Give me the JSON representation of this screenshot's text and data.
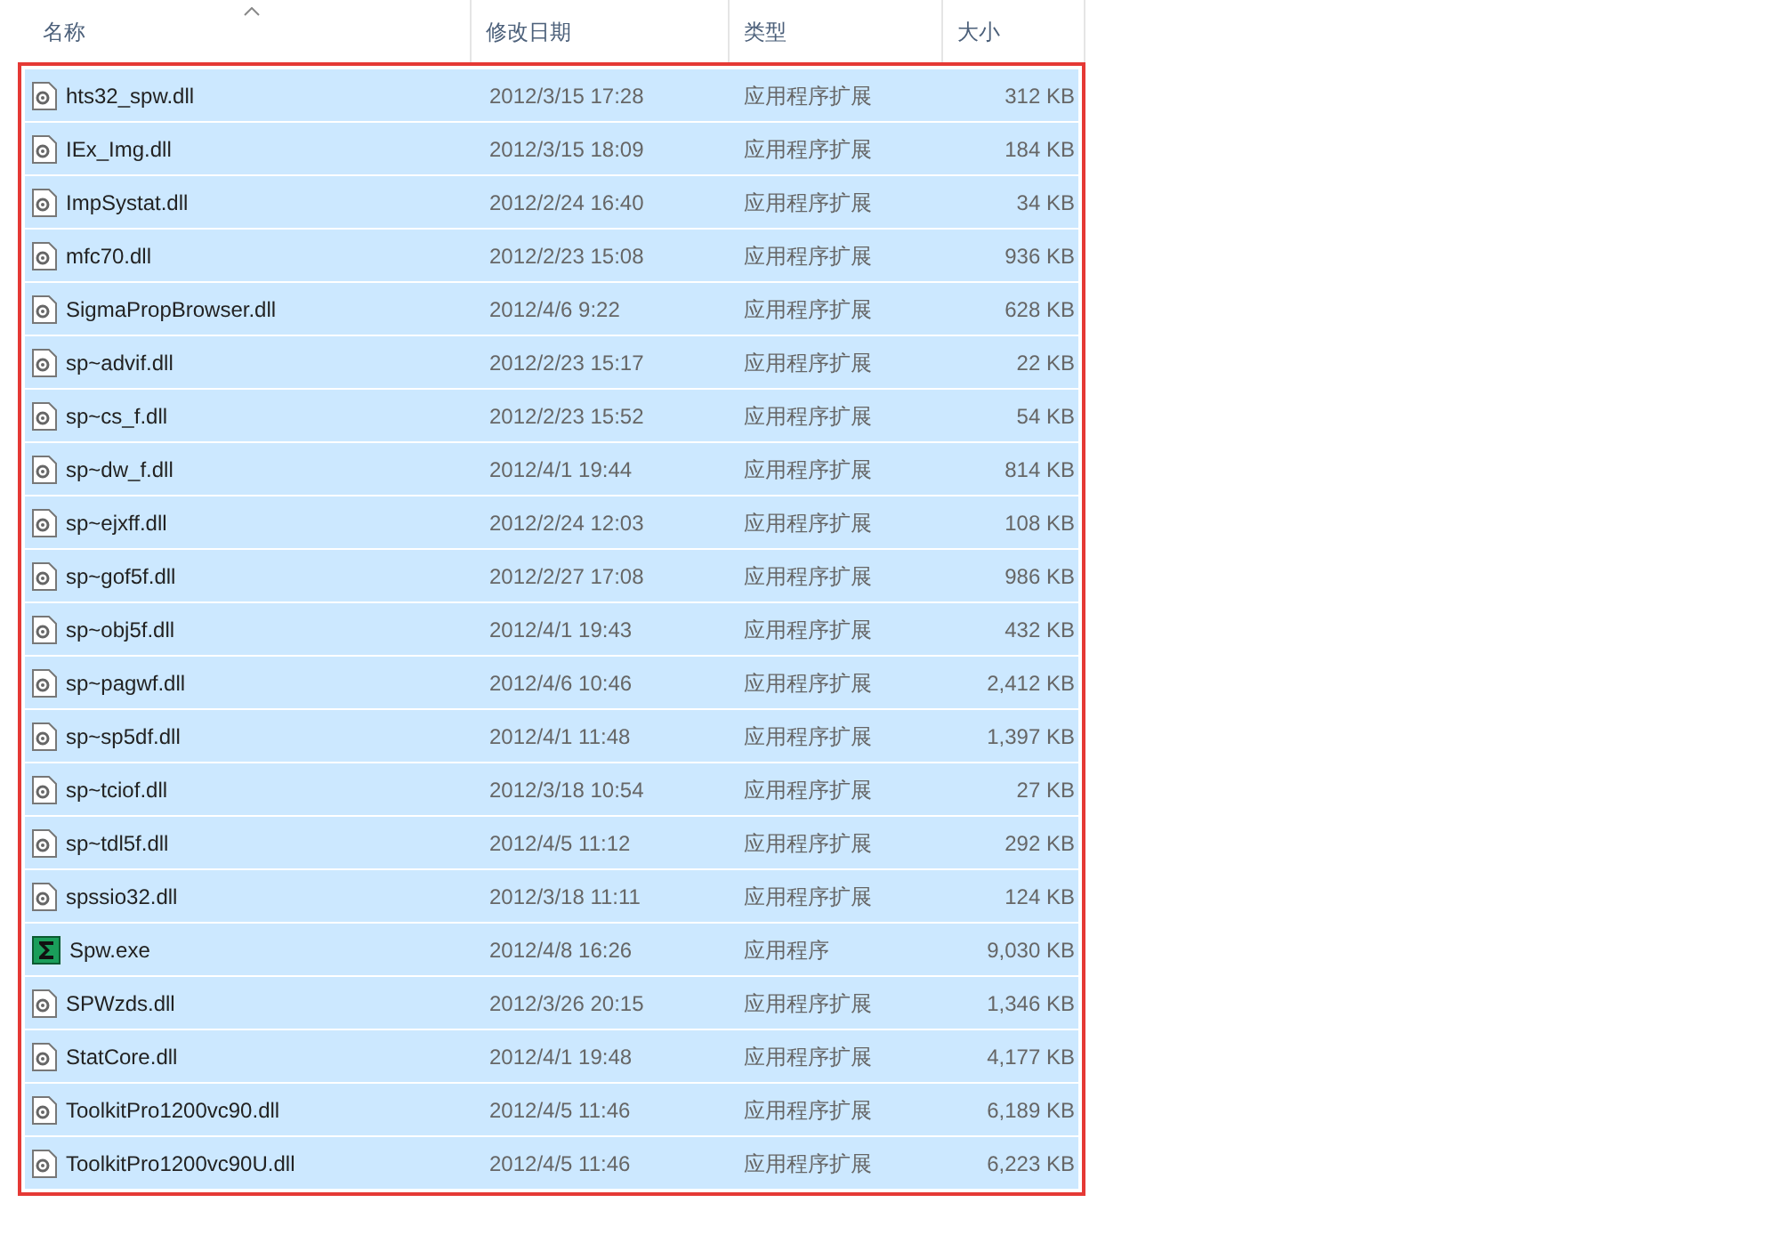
{
  "columns": [
    {
      "label": "名称",
      "sorted": true
    },
    {
      "label": "修改日期",
      "sorted": false
    },
    {
      "label": "类型",
      "sorted": false
    },
    {
      "label": "大小",
      "sorted": false
    }
  ],
  "highlight_box": true,
  "rows": [
    {
      "name": "hts32_spw.dll",
      "date": "2012/3/15 17:28",
      "type": "应用程序扩展",
      "size": "312 KB",
      "kind": "dll",
      "selected": true
    },
    {
      "name": "IEx_Img.dll",
      "date": "2012/3/15 18:09",
      "type": "应用程序扩展",
      "size": "184 KB",
      "kind": "dll",
      "selected": true
    },
    {
      "name": "ImpSystat.dll",
      "date": "2012/2/24 16:40",
      "type": "应用程序扩展",
      "size": "34 KB",
      "kind": "dll",
      "selected": true
    },
    {
      "name": "mfc70.dll",
      "date": "2012/2/23 15:08",
      "type": "应用程序扩展",
      "size": "936 KB",
      "kind": "dll",
      "selected": true
    },
    {
      "name": "SigmaPropBrowser.dll",
      "date": "2012/4/6 9:22",
      "type": "应用程序扩展",
      "size": "628 KB",
      "kind": "dll",
      "selected": true
    },
    {
      "name": "sp~advif.dll",
      "date": "2012/2/23 15:17",
      "type": "应用程序扩展",
      "size": "22 KB",
      "kind": "dll",
      "selected": true
    },
    {
      "name": "sp~cs_f.dll",
      "date": "2012/2/23 15:52",
      "type": "应用程序扩展",
      "size": "54 KB",
      "kind": "dll",
      "selected": true
    },
    {
      "name": "sp~dw_f.dll",
      "date": "2012/4/1 19:44",
      "type": "应用程序扩展",
      "size": "814 KB",
      "kind": "dll",
      "selected": true
    },
    {
      "name": "sp~ejxff.dll",
      "date": "2012/2/24 12:03",
      "type": "应用程序扩展",
      "size": "108 KB",
      "kind": "dll",
      "selected": true
    },
    {
      "name": "sp~gof5f.dll",
      "date": "2012/2/27 17:08",
      "type": "应用程序扩展",
      "size": "986 KB",
      "kind": "dll",
      "selected": true
    },
    {
      "name": "sp~obj5f.dll",
      "date": "2012/4/1 19:43",
      "type": "应用程序扩展",
      "size": "432 KB",
      "kind": "dll",
      "selected": true
    },
    {
      "name": "sp~pagwf.dll",
      "date": "2012/4/6 10:46",
      "type": "应用程序扩展",
      "size": "2,412 KB",
      "kind": "dll",
      "selected": true
    },
    {
      "name": "sp~sp5df.dll",
      "date": "2012/4/1 11:48",
      "type": "应用程序扩展",
      "size": "1,397 KB",
      "kind": "dll",
      "selected": true
    },
    {
      "name": "sp~tciof.dll",
      "date": "2012/3/18 10:54",
      "type": "应用程序扩展",
      "size": "27 KB",
      "kind": "dll",
      "selected": true
    },
    {
      "name": "sp~tdl5f.dll",
      "date": "2012/4/5 11:12",
      "type": "应用程序扩展",
      "size": "292 KB",
      "kind": "dll",
      "selected": true
    },
    {
      "name": "spssio32.dll",
      "date": "2012/3/18 11:11",
      "type": "应用程序扩展",
      "size": "124 KB",
      "kind": "dll",
      "selected": true
    },
    {
      "name": "Spw.exe",
      "date": "2012/4/8 16:26",
      "type": "应用程序",
      "size": "9,030 KB",
      "kind": "exe",
      "selected": true
    },
    {
      "name": "SPWzds.dll",
      "date": "2012/3/26 20:15",
      "type": "应用程序扩展",
      "size": "1,346 KB",
      "kind": "dll",
      "selected": true
    },
    {
      "name": "StatCore.dll",
      "date": "2012/4/1 19:48",
      "type": "应用程序扩展",
      "size": "4,177 KB",
      "kind": "dll",
      "selected": true
    },
    {
      "name": "ToolkitPro1200vc90.dll",
      "date": "2012/4/5 11:46",
      "type": "应用程序扩展",
      "size": "6,189 KB",
      "kind": "dll",
      "selected": true
    },
    {
      "name": "ToolkitPro1200vc90U.dll",
      "date": "2012/4/5 11:46",
      "type": "应用程序扩展",
      "size": "6,223 KB",
      "kind": "dll",
      "selected": true
    }
  ]
}
